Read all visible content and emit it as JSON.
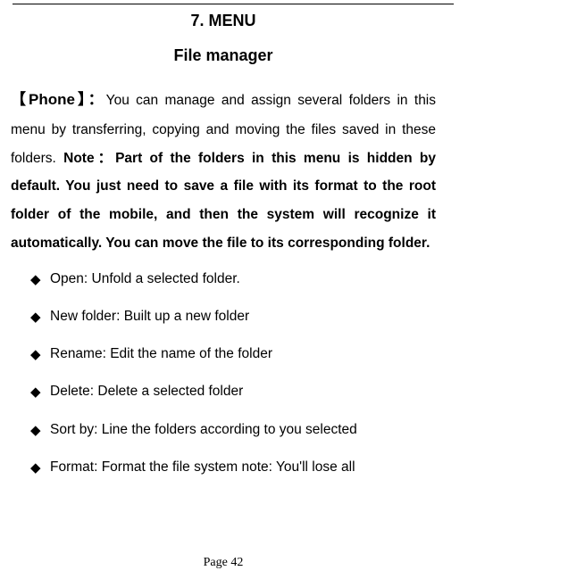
{
  "heading_number": "7. MENU",
  "heading_section": "File manager",
  "phone_bracket": "【Phone】：",
  "para_intro": "You can manage and assign several folders in this menu by transferring, copying and moving the files saved in these folders. ",
  "note_label": "Note：",
  "note_bold": "Part of the folders in this menu is hidden by default. You just need to save a file with its format to the root folder of the mobile, and then the system will recognize it automatically. You can move the file to its corresponding folder.",
  "items": [
    "Open: Unfold a selected folder.",
    "New folder: Built up a new folder",
    "Rename: Edit the name of the folder",
    "Delete: Delete a selected folder",
    "Sort by: Line the folders according to you selected",
    "Format: Format the file system  note: You'll lose all"
  ],
  "page_number": "Page 42"
}
